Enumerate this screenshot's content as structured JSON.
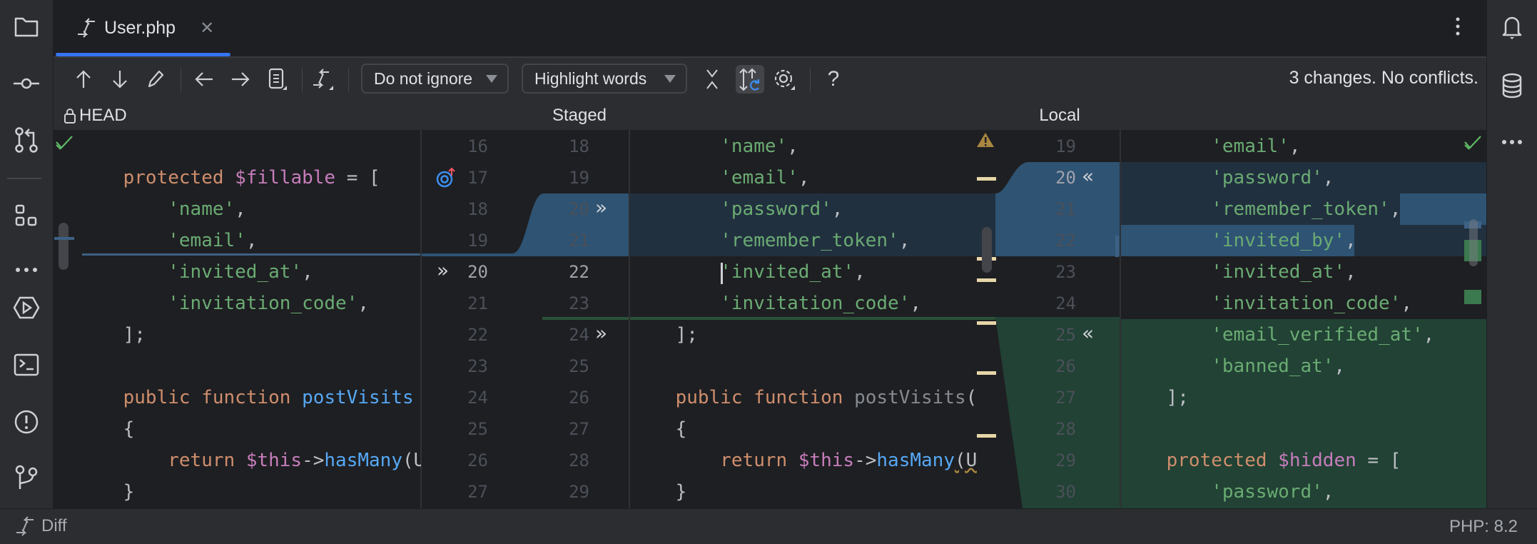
{
  "tab": {
    "title": "User.php",
    "close_icon": "close-icon",
    "more_icon": "kebab-icon"
  },
  "toolbar": {
    "ignore_dropdown": "Do not ignore",
    "highlight_dropdown": "Highlight words",
    "help": "?",
    "status": "3 changes. No conflicts."
  },
  "columns": {
    "left": "HEAD",
    "middle": "Staged",
    "right": "Local"
  },
  "gutter": {
    "left_numbers": [
      "16",
      "17",
      "18",
      "19",
      "20",
      "21",
      "22",
      "23",
      "24",
      "25",
      "26",
      "27"
    ],
    "staged_numbers": [
      "18",
      "19",
      "20",
      "21",
      "22",
      "23",
      "24",
      "25",
      "26",
      "27",
      "28",
      "29"
    ],
    "local_numbers": [
      "19",
      "20",
      "21",
      "22",
      "23",
      "24",
      "25",
      "26",
      "27",
      "28",
      "29",
      "30"
    ]
  },
  "panes": {
    "left": {
      "lines": [
        {
          "tokens": []
        },
        {
          "tokens": [
            {
              "t": "pl",
              "v": "    "
            },
            {
              "t": "kw",
              "v": "protected"
            },
            {
              "t": "pl",
              "v": " "
            },
            {
              "t": "var",
              "v": "$fillable"
            },
            {
              "t": "pl",
              "v": " = ["
            }
          ]
        },
        {
          "tokens": [
            {
              "t": "pl",
              "v": "        "
            },
            {
              "t": "str",
              "v": "'name'"
            },
            {
              "t": "pl",
              "v": ","
            }
          ]
        },
        {
          "tokens": [
            {
              "t": "pl",
              "v": "        "
            },
            {
              "t": "str",
              "v": "'email'"
            },
            {
              "t": "pl",
              "v": ","
            }
          ]
        },
        {
          "tokens": [
            {
              "t": "pl",
              "v": "        "
            },
            {
              "t": "str",
              "v": "'invited_at'"
            },
            {
              "t": "pl",
              "v": ","
            }
          ]
        },
        {
          "tokens": [
            {
              "t": "pl",
              "v": "        "
            },
            {
              "t": "str",
              "v": "'invitation_code'"
            },
            {
              "t": "pl",
              "v": ","
            }
          ]
        },
        {
          "tokens": [
            {
              "t": "pl",
              "v": "    ];"
            }
          ]
        },
        {
          "tokens": []
        },
        {
          "tokens": [
            {
              "t": "pl",
              "v": "    "
            },
            {
              "t": "kw",
              "v": "public"
            },
            {
              "t": "pl",
              "v": " "
            },
            {
              "t": "kw",
              "v": "function"
            },
            {
              "t": "pl",
              "v": " "
            },
            {
              "t": "fn",
              "v": "postVisits"
            }
          ]
        },
        {
          "tokens": [
            {
              "t": "pl",
              "v": "    {"
            }
          ]
        },
        {
          "tokens": [
            {
              "t": "pl",
              "v": "        "
            },
            {
              "t": "kw",
              "v": "return"
            },
            {
              "t": "pl",
              "v": " "
            },
            {
              "t": "var",
              "v": "$this"
            },
            {
              "t": "pl",
              "v": "->"
            },
            {
              "t": "fn",
              "v": "hasMany"
            },
            {
              "t": "pl",
              "v": "(U"
            }
          ]
        },
        {
          "tokens": [
            {
              "t": "pl",
              "v": "    }"
            }
          ]
        }
      ]
    },
    "staged": {
      "lines": [
        {
          "tokens": [
            {
              "t": "pl",
              "v": "        "
            },
            {
              "t": "str",
              "v": "'name'"
            },
            {
              "t": "pl",
              "v": ","
            }
          ]
        },
        {
          "tokens": [
            {
              "t": "pl",
              "v": "        "
            },
            {
              "t": "str",
              "v": "'email'"
            },
            {
              "t": "pl",
              "v": ","
            }
          ]
        },
        {
          "tokens": [
            {
              "t": "pl",
              "v": "        "
            },
            {
              "t": "str",
              "v": "'password'"
            },
            {
              "t": "pl",
              "v": ","
            }
          ]
        },
        {
          "tokens": [
            {
              "t": "pl",
              "v": "        "
            },
            {
              "t": "str",
              "v": "'remember_token'"
            },
            {
              "t": "pl",
              "v": ","
            }
          ]
        },
        {
          "tokens": [
            {
              "t": "pl",
              "v": "        "
            },
            {
              "t": "str",
              "v": "'invited_at'"
            },
            {
              "t": "pl",
              "v": ","
            }
          ]
        },
        {
          "tokens": [
            {
              "t": "pl",
              "v": "        "
            },
            {
              "t": "str",
              "v": "'invitation_code'"
            },
            {
              "t": "pl",
              "v": ","
            }
          ]
        },
        {
          "tokens": [
            {
              "t": "pl",
              "v": "    ];"
            }
          ]
        },
        {
          "tokens": []
        },
        {
          "tokens": [
            {
              "t": "pl",
              "v": "    "
            },
            {
              "t": "kw",
              "v": "public"
            },
            {
              "t": "pl",
              "v": " "
            },
            {
              "t": "kw",
              "v": "function"
            },
            {
              "t": "pl",
              "v": " "
            },
            {
              "t": "dim",
              "v": "postVisits"
            },
            {
              "t": "pl",
              "v": "():"
            }
          ]
        },
        {
          "tokens": [
            {
              "t": "pl",
              "v": "    {"
            }
          ]
        },
        {
          "tokens": [
            {
              "t": "pl",
              "v": "        "
            },
            {
              "t": "kw",
              "v": "return"
            },
            {
              "t": "pl",
              "v": " "
            },
            {
              "t": "var",
              "v": "$this"
            },
            {
              "t": "pl",
              "v": "->"
            },
            {
              "t": "fn",
              "v": "hasMany"
            },
            {
              "t": "pl",
              "v": "(Use"
            }
          ]
        },
        {
          "tokens": [
            {
              "t": "pl",
              "v": "    }"
            }
          ]
        }
      ]
    },
    "local": {
      "lines": [
        {
          "tokens": [
            {
              "t": "pl",
              "v": "        "
            },
            {
              "t": "str",
              "v": "'email'"
            },
            {
              "t": "pl",
              "v": ","
            }
          ]
        },
        {
          "tokens": [
            {
              "t": "pl",
              "v": "        "
            },
            {
              "t": "str",
              "v": "'password'"
            },
            {
              "t": "pl",
              "v": ","
            }
          ]
        },
        {
          "tokens": [
            {
              "t": "pl",
              "v": "        "
            },
            {
              "t": "str",
              "v": "'remember_token'"
            },
            {
              "t": "pl",
              "v": ","
            }
          ]
        },
        {
          "tokens": [
            {
              "t": "pl",
              "v": "        "
            },
            {
              "t": "str",
              "v": "'invited_by'"
            },
            {
              "t": "pl",
              "v": ","
            }
          ]
        },
        {
          "tokens": [
            {
              "t": "pl",
              "v": "        "
            },
            {
              "t": "str",
              "v": "'invited_at'"
            },
            {
              "t": "pl",
              "v": ","
            }
          ]
        },
        {
          "tokens": [
            {
              "t": "pl",
              "v": "        "
            },
            {
              "t": "str",
              "v": "'invitation_code'"
            },
            {
              "t": "pl",
              "v": ","
            }
          ]
        },
        {
          "tokens": [
            {
              "t": "pl",
              "v": "        "
            },
            {
              "t": "str",
              "v": "'email_verified_at'"
            },
            {
              "t": "pl",
              "v": ","
            }
          ]
        },
        {
          "tokens": [
            {
              "t": "pl",
              "v": "        "
            },
            {
              "t": "str",
              "v": "'banned_at'"
            },
            {
              "t": "pl",
              "v": ","
            }
          ]
        },
        {
          "tokens": [
            {
              "t": "pl",
              "v": "    ];"
            }
          ]
        },
        {
          "tokens": []
        },
        {
          "tokens": [
            {
              "t": "pl",
              "v": "    "
            },
            {
              "t": "kw",
              "v": "protected"
            },
            {
              "t": "pl",
              "v": " "
            },
            {
              "t": "var",
              "v": "$hidden"
            },
            {
              "t": "pl",
              "v": " = ["
            }
          ]
        },
        {
          "tokens": [
            {
              "t": "pl",
              "v": "        "
            },
            {
              "t": "str",
              "v": "'password'"
            },
            {
              "t": "pl",
              "v": ","
            }
          ]
        }
      ]
    }
  },
  "statusbar": {
    "left": "Diff",
    "right": "PHP: 8.2"
  },
  "colors": {
    "accent": "#3574f0",
    "modified": "#2e5373",
    "added": "#214234",
    "string": "#6aab73",
    "keyword": "#cf8e6d"
  }
}
